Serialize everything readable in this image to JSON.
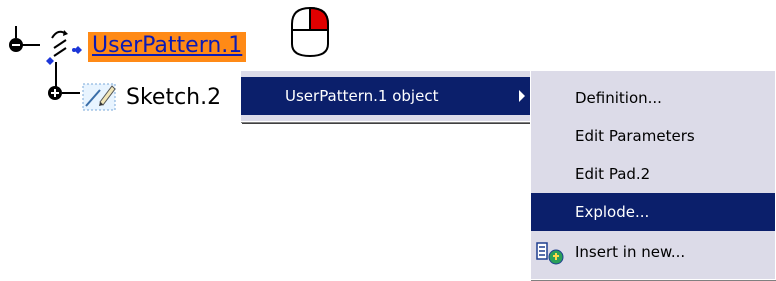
{
  "tree": {
    "root_label": "UserPattern.1",
    "child_label": "Sketch.2"
  },
  "context_menu": {
    "item_label": "UserPattern.1 object"
  },
  "submenu": {
    "items": [
      {
        "label": "Definition..."
      },
      {
        "label": "Edit Parameters"
      },
      {
        "label": "Edit Pad.2"
      },
      {
        "label": "Explode..."
      },
      {
        "label": "Insert in new..."
      }
    ],
    "highlighted_index": 3
  },
  "colors": {
    "selection_bg": "#ff8a16",
    "selection_text": "#0b1bb6",
    "menu_bg": "#dcdbe8",
    "menu_highlight": "#0b1f6b",
    "mouse_button_active": "#e00000"
  }
}
